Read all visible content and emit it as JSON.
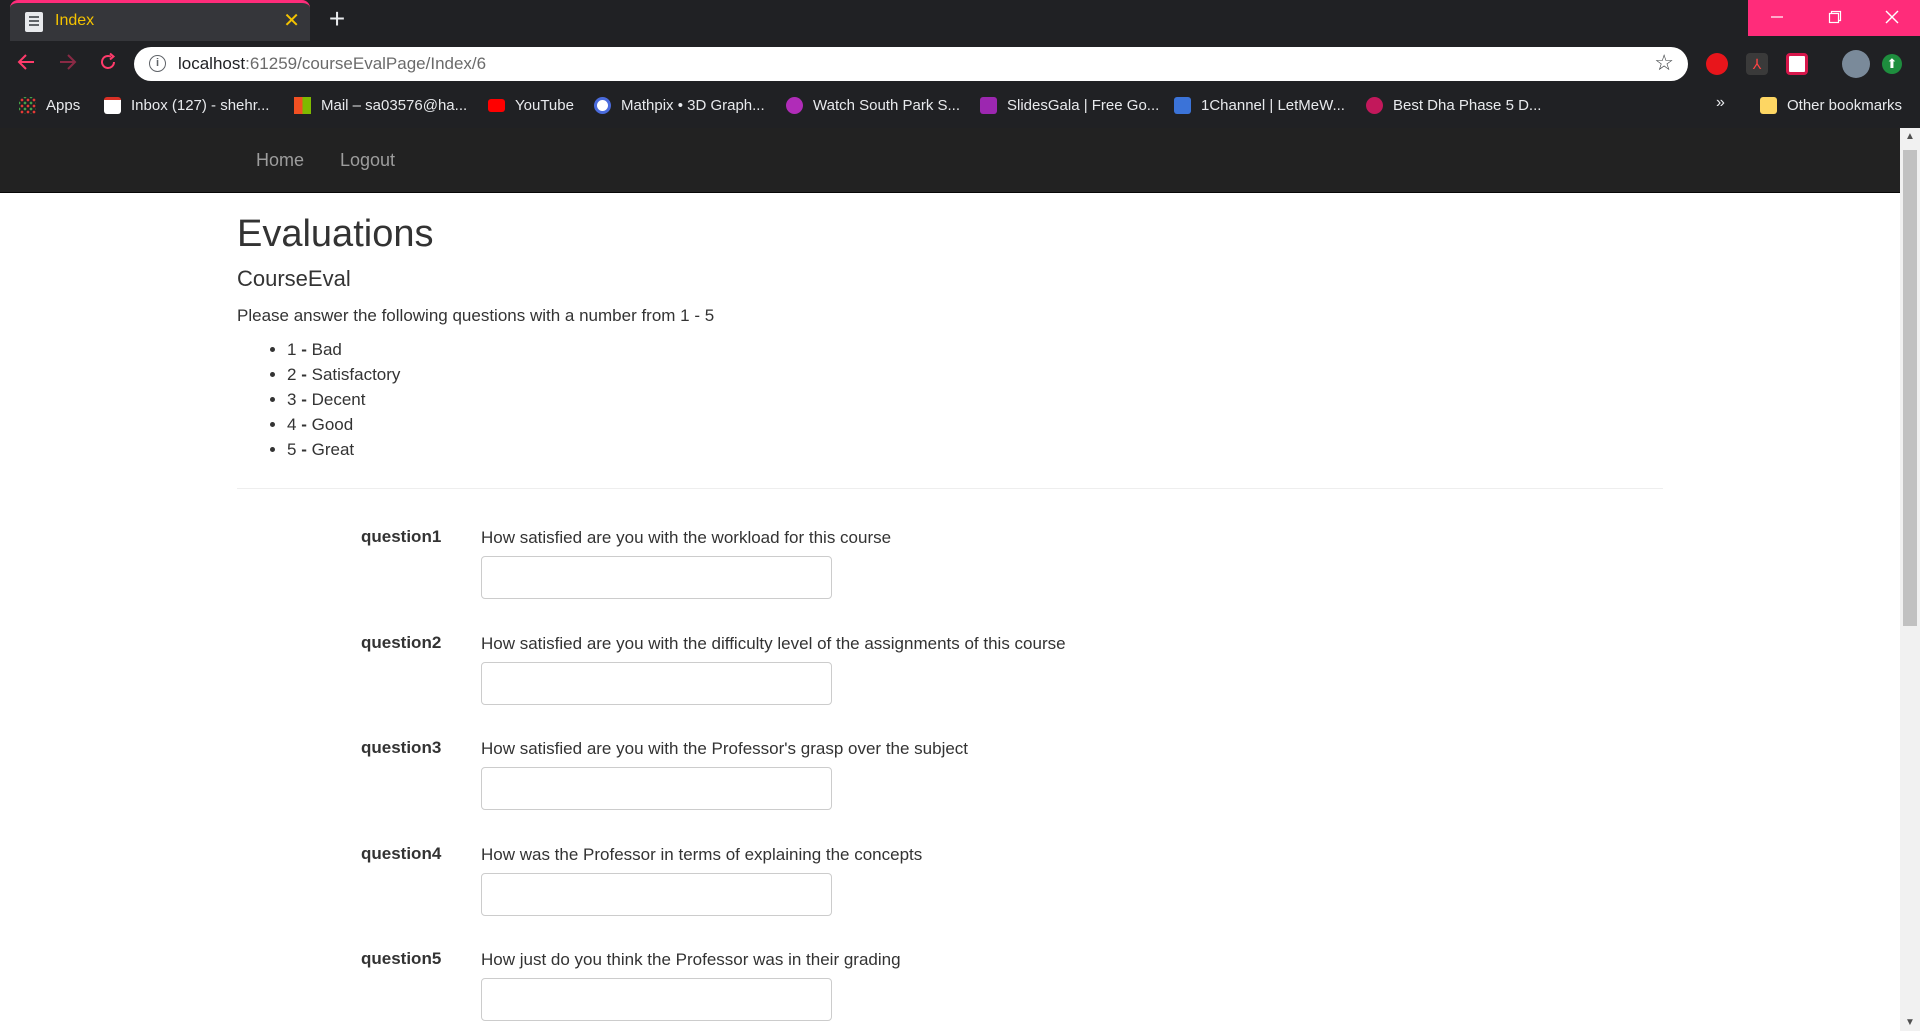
{
  "browser": {
    "tab_title": "Index",
    "tab_close": "✕",
    "new_tab": "+",
    "url_host": "localhost",
    "url_path": ":61259/courseEvalPage/Index/6",
    "accent_color": "#ff2c7a",
    "bookmarks": [
      {
        "label": "Apps",
        "icon": "apps-grid-icon"
      },
      {
        "label": "Inbox (127) - shehr...",
        "icon": "gmail-icon"
      },
      {
        "label": "Mail – sa03576@ha...",
        "icon": "microsoft-icon"
      },
      {
        "label": "YouTube",
        "icon": "youtube-icon"
      },
      {
        "label": "Mathpix • 3D Graph...",
        "icon": "mathpix-icon"
      },
      {
        "label": "Watch South Park S...",
        "icon": "play-icon"
      },
      {
        "label": "SlidesGala | Free Go...",
        "icon": "check-icon"
      },
      {
        "label": "1Channel | LetMeW...",
        "icon": "film-icon"
      },
      {
        "label": "Best Dha Phase 5 D...",
        "icon": "panda-icon"
      }
    ],
    "more_bookmarks": "»",
    "other_bookmarks": "Other bookmarks"
  },
  "nav": {
    "home": "Home",
    "logout": "Logout"
  },
  "page": {
    "title": "Evaluations",
    "subtitle": "CourseEval",
    "intro": "Please answer the following questions with a number from 1 - 5",
    "scale": [
      {
        "num": "1",
        "text": "Bad"
      },
      {
        "num": "2",
        "text": "Satisfactory"
      },
      {
        "num": "3",
        "text": "Decent"
      },
      {
        "num": "4",
        "text": "Good"
      },
      {
        "num": "5",
        "text": "Great"
      }
    ]
  },
  "questions": [
    {
      "label": "question1",
      "text": "How satisfied are you with the workload for this course",
      "value": ""
    },
    {
      "label": "question2",
      "text": "How satisfied are you with the difficulty level of the assignments of this course",
      "value": ""
    },
    {
      "label": "question3",
      "text": "How satisfied are you with the Professor's grasp over the subject",
      "value": ""
    },
    {
      "label": "question4",
      "text": "How was the Professor in terms of explaining the concepts",
      "value": ""
    },
    {
      "label": "question5",
      "text": "How just do you think the Professor was in their grading",
      "value": ""
    }
  ]
}
